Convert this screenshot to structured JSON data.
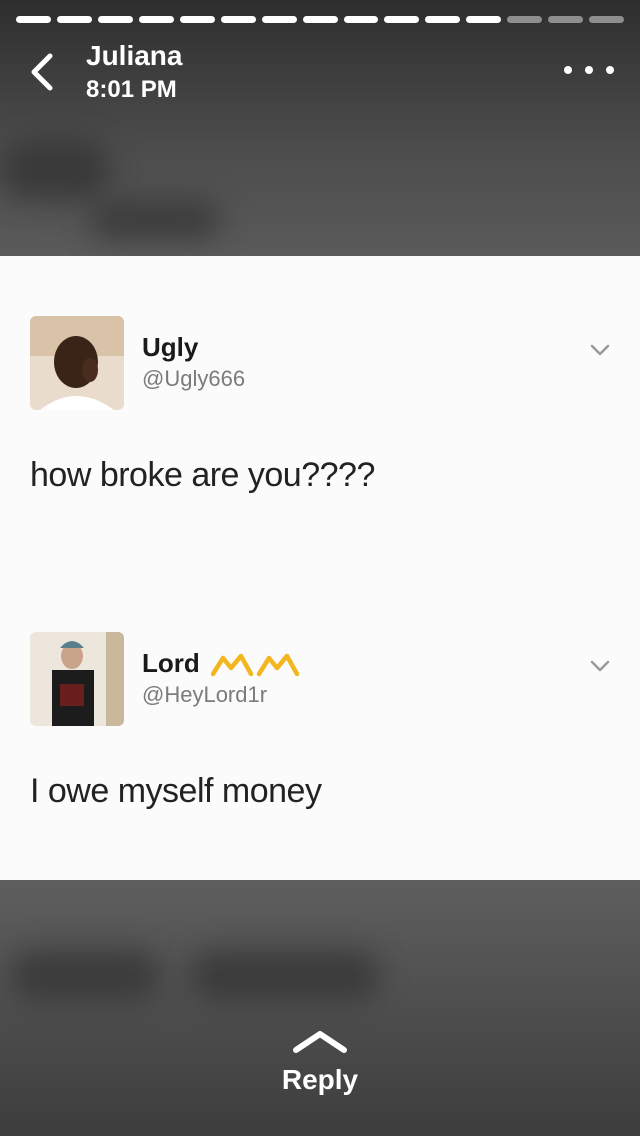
{
  "story": {
    "progress": {
      "total_segments": 15,
      "completed_segments": 12
    },
    "sender_name": "Juliana",
    "time": "8:01 PM"
  },
  "tweets": [
    {
      "name": "Ugly",
      "handle": "@Ugly666",
      "text": "how broke are you????"
    },
    {
      "name": "Lord",
      "handle": "@HeyLord1r",
      "text": "I owe myself money"
    }
  ],
  "reply": {
    "label": "Reply"
  },
  "colors": {
    "crown": "#f3b61f",
    "card_bg": "#fbfbfb",
    "handle_gray": "#7b7b7b"
  },
  "icons": {
    "back": "chevron-left-icon",
    "more": "more-dots-icon",
    "tweet_menu": "chevron-down-icon",
    "reply": "chevron-up-icon"
  }
}
